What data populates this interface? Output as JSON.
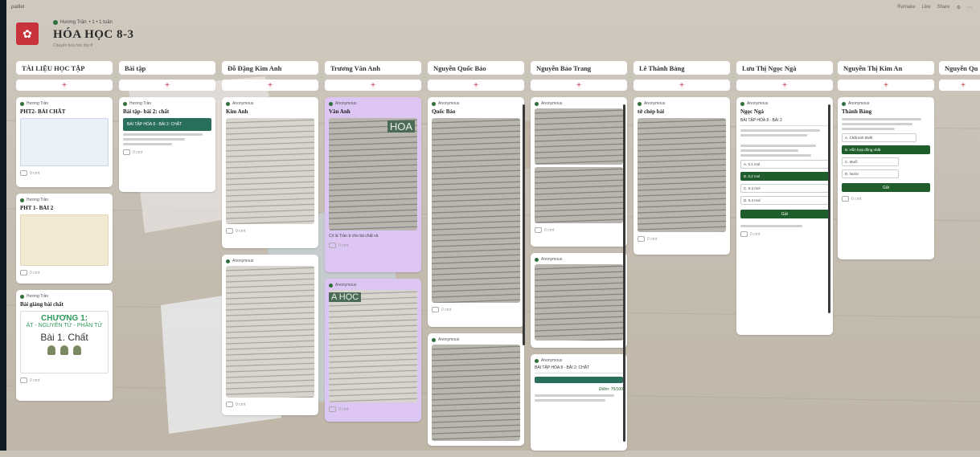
{
  "app": {
    "brand": "padlet"
  },
  "header": {
    "author": "Hương Trần",
    "author_meta": "• 1 • 1 tuần",
    "title": "HÓA HỌC 8-3",
    "subtitle": "Chuyên hoá học lớp 8",
    "actions": [
      "Remake",
      "Like",
      "Share",
      "⚙",
      "⋯"
    ]
  },
  "columns": [
    {
      "title": "TÀI LIỆU HỌC TẬP",
      "add": "+"
    },
    {
      "title": "Bài tập",
      "add": "+"
    },
    {
      "title": "Đỗ Đặng Kim Anh",
      "add": "+"
    },
    {
      "title": "Trương Vân Anh",
      "add": "+"
    },
    {
      "title": "Nguyễn Quốc Bảo",
      "add": "+"
    },
    {
      "title": "Nguyễn Bảo Trang",
      "add": "+"
    },
    {
      "title": "Lê Thành Bảng",
      "add": "+"
    },
    {
      "title": "Lưu Thị Ngọc Ngà",
      "add": "+"
    },
    {
      "title": "Nguyễn Thị Kim An",
      "add": "+"
    },
    {
      "title": "Nguyễn Qu",
      "add": "+"
    }
  ],
  "cards": {
    "c1a": {
      "author": "Hương Trần",
      "title": "PHT2- BÀI CHẤT",
      "comment": "0 cmt"
    },
    "c1b": {
      "author": "Hương Trần",
      "title": "PHT 1- BÀI 2",
      "comment": "0 cmt"
    },
    "c1c": {
      "author": "Hương Trần",
      "title": "Bài giảng bài chất",
      "comment": "0 cmt",
      "slide_ch": "CHƯƠNG 1:",
      "slide_sub": "ÁT - NGUYÊN TỬ - PHÂN TỬ",
      "slide_bai": "Bài 1. Chất"
    },
    "c2a": {
      "author": "Hương Trần",
      "title": "Bài tập- bài 2: chất",
      "comment": "0 cmt",
      "banner": "BÀI TẬP HÓA 8 - BÀI 2: CHẤT"
    },
    "c3a": {
      "author": "Anonymous",
      "title": "Kim Anh",
      "comment": "0 cmt"
    },
    "c3b": {
      "author": "Anonymous",
      "title": "",
      "comment": "0 cmt"
    },
    "c4a": {
      "author": "Anonymous",
      "title": "Vân Anh",
      "comment": "0 cmt",
      "photo_text": "HOA",
      "caption": "Cô là Trần tr cho bà chất vâ"
    },
    "c4b": {
      "author": "Anonymous",
      "title": "",
      "comment": "0 cmt",
      "photo_text": "A HỌC"
    },
    "c5a": {
      "author": "Anonymous",
      "title": "Quốc Bảo",
      "comment": "0 cmt"
    },
    "c5b": {
      "author": "Anonymous",
      "title": "",
      "comment": ""
    },
    "c6a": {
      "author": "Anonymous",
      "title": "",
      "comment": "0 cmt"
    },
    "c6b": {
      "author": "Anonymous",
      "title": "",
      "comment": ""
    },
    "c6c": {
      "author": "Anonymous",
      "title": "",
      "comment": "",
      "banner": "BÀI TẬP HÓA 8 - BÀI 2: CHẤT",
      "score": "Điểm: 75/100"
    },
    "c7a": {
      "author": "Anonymous",
      "title": "tớ chép bài",
      "comment": "0 cmt"
    },
    "c8a": {
      "author": "Anonymous",
      "title": "Ngọc Ngà",
      "comment": "0 cmt",
      "quiz_title": "BÀI TẬP HÓA 8 - BÀI 2",
      "btn": "Gửi",
      "options": [
        "A. 0,1 mol",
        "B. 0,2 mol",
        "C. 0,3 mol",
        "D. 0,4 mol"
      ]
    },
    "c9a": {
      "author": "Anonymous",
      "title": "Thành Bảng",
      "comment": "0 cmt",
      "btn": "Gửi",
      "options": [
        "A. Chất tinh khiết",
        "B. Hỗn hợp đồng nhất",
        "C. Muối",
        "D. Nước"
      ]
    }
  },
  "colors": {
    "accent": "#c62d3a",
    "quiz_green": "#1f5e2c",
    "purple_card": "#ddc6f4"
  }
}
